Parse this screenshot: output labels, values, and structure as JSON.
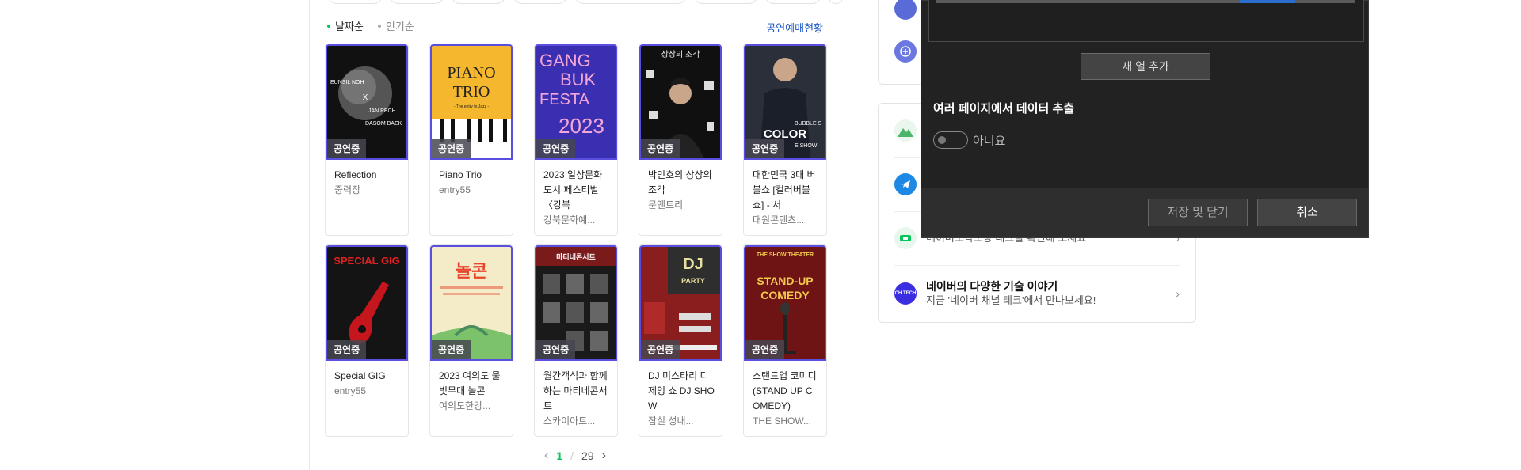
{
  "sort": {
    "date_label": "날짜순",
    "popular_label": "인기순"
  },
  "status_link": "공연예매현황",
  "badge_label": "공연중",
  "performances": [
    {
      "title": "Reflection",
      "venue": "중력장"
    },
    {
      "title": "Piano Trio",
      "venue": "entry55"
    },
    {
      "title": "2023 일상문화도시 페스티벌 〈강북",
      "venue": "강북문화예..."
    },
    {
      "title": "박민호의 상상의 조각",
      "venue": "문엔트리"
    },
    {
      "title": "대한민국 3대 버블쇼 [컬러버블쇼] - 서",
      "venue": "대원콘텐츠..."
    },
    {
      "title": "Special GIG",
      "venue": "entry55"
    },
    {
      "title": "2023 여의도 물빛무대 놀콘",
      "venue": "여의도한강..."
    },
    {
      "title": "월간객석과 함께하는 마티네콘서트",
      "venue": "스카이아트..."
    },
    {
      "title": "DJ 미스타리 디제잉 쇼 DJ SHOW",
      "venue": "잠실 성내..."
    },
    {
      "title": "스탠드업 코미디 (STAND UP COMEDY)",
      "venue": "THE SHOW..."
    }
  ],
  "posters": [
    {
      "lines": [
        "EUNSIL NOH",
        "X",
        "JAN PECH",
        "DASOM BAEK"
      ]
    },
    {
      "lines": [
        "PIANO",
        "TRIO",
        "- The entry to Jazz -"
      ]
    },
    {
      "lines": [
        "GANG",
        "BUK",
        "FESTA",
        "2023"
      ]
    },
    {
      "lines": [
        "상상의 조각"
      ]
    },
    {
      "lines": [
        "BUBBLE S",
        "COLOR",
        "E SHOW"
      ]
    },
    {
      "lines": [
        "SPECIAL GIG"
      ]
    },
    {
      "lines": [
        "놀콘"
      ]
    },
    {
      "lines": [
        "마티네콘서트"
      ]
    },
    {
      "lines": [
        "DJ",
        "PARTY"
      ]
    },
    {
      "lines": [
        "THE SHOW THEATER",
        "STAND-UP",
        "COMEDY"
      ]
    }
  ],
  "pager": {
    "current": "1",
    "separator": "/",
    "total": "29"
  },
  "services": [
    {
      "title": "",
      "sub": ""
    },
    {
      "title": "",
      "sub": ""
    },
    {
      "title": "",
      "sub": "네이버도착보장 태그를 확인해 보세요"
    },
    {
      "title": "네이버의 다양한 기술 이야기",
      "sub": "지금 '네이버 채널 테크'에서 만나보세요!",
      "icon_text": "CH.TECH"
    }
  ],
  "dialog": {
    "add_column": "새 열 추가",
    "multi_page_heading": "여러 페이지에서 데이터 추출",
    "toggle_label": "아니요",
    "toggle_on": false,
    "save_close": "저장 및 닫기",
    "cancel": "취소"
  },
  "colors": {
    "accent_green": "#03c75a",
    "poster_border": "#5a4ee0",
    "link_blue": "#1a55c4",
    "dialog_bg": "#222222"
  }
}
